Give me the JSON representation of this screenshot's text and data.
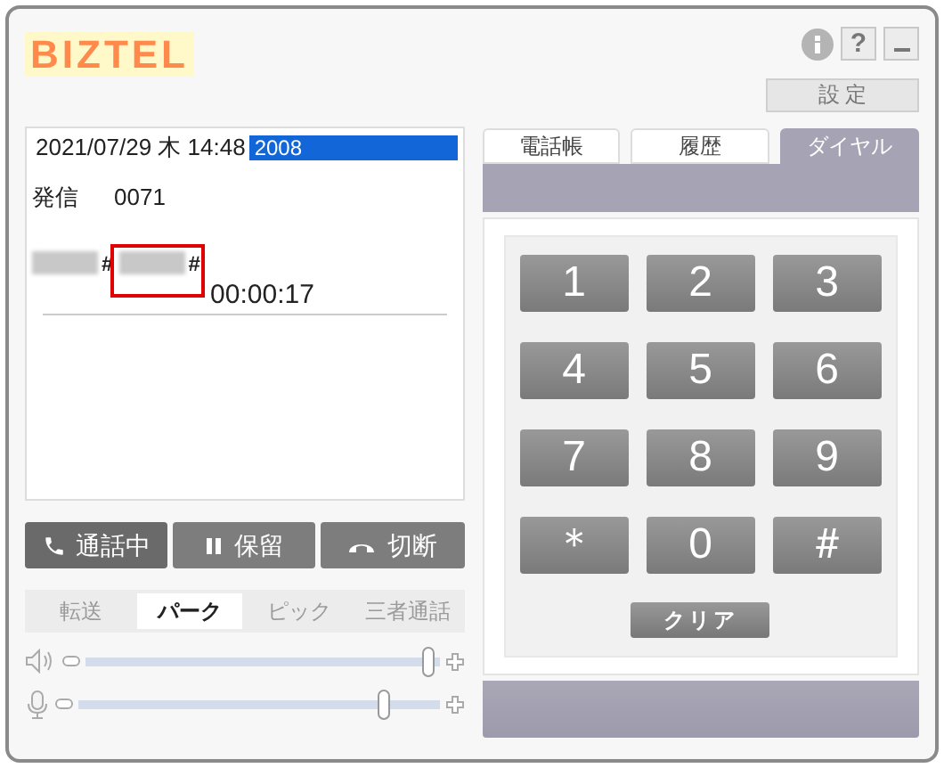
{
  "header": {
    "logo": "BIZTEL",
    "help": "?",
    "settings": "設 定"
  },
  "call": {
    "datetime": "2021/07/29 木 14:48",
    "extension": {
      "text": "2008",
      "selected": true
    },
    "direction": "発信",
    "number": "0071",
    "dialed": [
      "#",
      "#"
    ],
    "duration": "00:00:17"
  },
  "call_buttons": [
    {
      "kind": "phone",
      "label": "通話中",
      "active": true
    },
    {
      "kind": "hold",
      "label": "保留",
      "active": false
    },
    {
      "kind": "hangup",
      "label": "切断",
      "active": false
    }
  ],
  "sub_tabs": [
    {
      "label": "転送",
      "selected": false,
      "disabled": true
    },
    {
      "label": "パーク",
      "selected": true,
      "disabled": false
    },
    {
      "label": "ピック",
      "selected": false,
      "disabled": true
    },
    {
      "label": "三者通話",
      "selected": false,
      "disabled": true
    }
  ],
  "volume": [
    {
      "kind": "speaker",
      "level": 0.97
    },
    {
      "kind": "mic",
      "level": 0.85
    }
  ],
  "tabs": [
    {
      "label": "電話帳",
      "selected": false
    },
    {
      "label": "履歴",
      "selected": false
    },
    {
      "label": "ダイヤル",
      "selected": true
    }
  ],
  "keys": [
    "1",
    "2",
    "3",
    "4",
    "5",
    "6",
    "7",
    "8",
    "9",
    "＊",
    "0",
    "＃"
  ],
  "clear": "クリア"
}
